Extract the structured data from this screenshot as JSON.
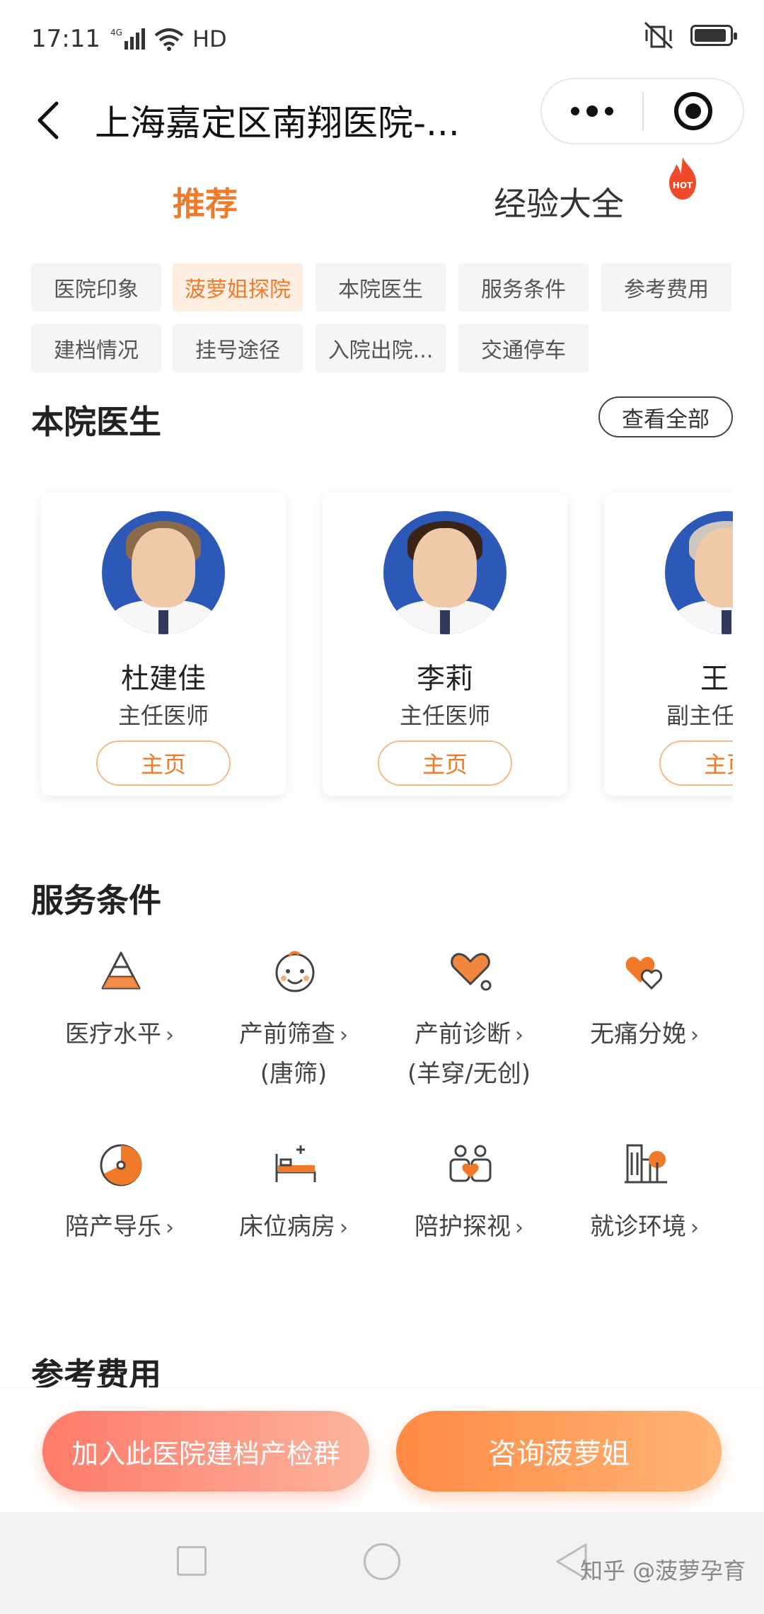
{
  "status_bar": {
    "time": "17:11",
    "network": "4G",
    "hd": "HD"
  },
  "title_bar": {
    "title": "上海嘉定区南翔医院-..."
  },
  "tabs": [
    {
      "label": "推荐"
    },
    {
      "label": "经验大全"
    }
  ],
  "hot_badge": "HOT",
  "chips": [
    {
      "label": "医院印象"
    },
    {
      "label": "菠萝姐探院"
    },
    {
      "label": "本院医生"
    },
    {
      "label": "服务条件"
    },
    {
      "label": "参考费用"
    },
    {
      "label": "建档情况"
    },
    {
      "label": "挂号途径"
    },
    {
      "label": "入院出院..."
    },
    {
      "label": "交通停车"
    }
  ],
  "doctors_section": {
    "title": "本院医生",
    "see_all": "查看全部",
    "doctors": [
      {
        "name": "杜建佳",
        "title": "主任医师",
        "button": "主页"
      },
      {
        "name": "李莉",
        "title": "主任医师",
        "button": "主页"
      },
      {
        "name": "王",
        "title": "副主任",
        "button": "主页"
      }
    ]
  },
  "services_section": {
    "title": "服务条件",
    "items": [
      {
        "line1": "医疗水平",
        "line2": "",
        "icon": "pyramid-icon"
      },
      {
        "line1": "产前筛查",
        "line2": "(唐筛)",
        "icon": "baby-face-icon"
      },
      {
        "line1": "产前诊断",
        "line2": "(羊穿/无创)",
        "icon": "stethoscope-heart-icon"
      },
      {
        "line1": "无痛分娩",
        "line2": "",
        "icon": "hearts-icon"
      },
      {
        "line1": "陪产导乐",
        "line2": "",
        "icon": "music-disc-icon"
      },
      {
        "line1": "床位病房",
        "line2": "",
        "icon": "bed-icon"
      },
      {
        "line1": "陪护探视",
        "line2": "",
        "icon": "companions-icon"
      },
      {
        "line1": "就诊环境",
        "line2": "",
        "icon": "building-tree-icon"
      }
    ],
    "chevron": "›"
  },
  "fees_section": {
    "title": "参考费用"
  },
  "actions": {
    "join": "加入此医院建档产检群",
    "consult": "咨询菠萝姐"
  },
  "watermark": "知乎 @菠萝孕育",
  "colors": {
    "accent": "#f07a2a",
    "accent_light": "#fdeee2",
    "chip_bg": "#f5f5f5"
  }
}
